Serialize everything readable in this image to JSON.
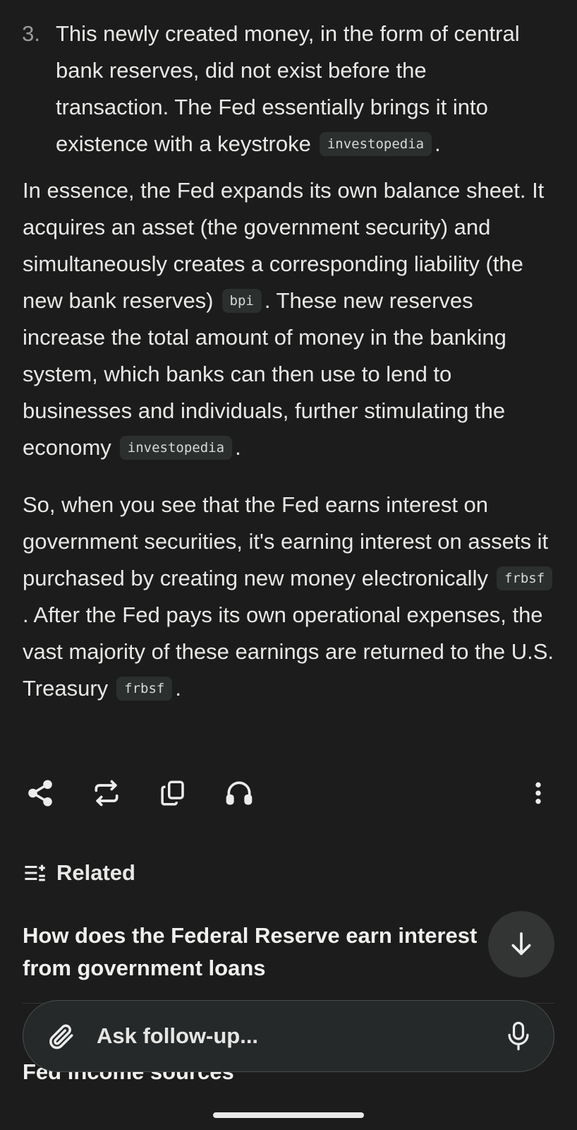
{
  "list": {
    "number": "3.",
    "text": "This newly created money, in the form of central bank reserves, did not exist before the transaction. The Fed essentially brings it into existence with a keystroke",
    "cite": "investopedia"
  },
  "paragraph1": {
    "text_a": "In essence, the Fed expands its own balance sheet. It acquires an asset (the government security) and simultaneously creates a corresponding liability (the new bank reserves)",
    "cite_a": "bpi",
    "text_b": ". These new reserves increase the total amount of money in the banking system, which banks can then use to lend to businesses and individuals, further stimulating the economy",
    "cite_b": "investopedia"
  },
  "paragraph2": {
    "text_a": "So, when you see that the Fed earns interest on government securities, it's earning interest on assets it purchased by creating new money electronically",
    "cite_a": "frbsf",
    "text_b": ". After the Fed pays its own operational expenses, the vast majority of these earnings are returned to the U.S. Treasury",
    "cite_b": "frbsf"
  },
  "period": ".",
  "toolbar": {
    "icons": [
      "share-icon",
      "rewrite-icon",
      "copy-icon",
      "headphones-icon",
      "more-vertical-icon"
    ]
  },
  "related": {
    "heading": "Related",
    "items": [
      "How does the Federal Reserve earn interest from government loans",
      "Fed income sources"
    ]
  },
  "ask": {
    "placeholder": "Ask follow-up..."
  },
  "colors": {
    "background": "#1c1c1c",
    "text": "#e8e8e6",
    "cite_bg": "#2b2f2e"
  }
}
